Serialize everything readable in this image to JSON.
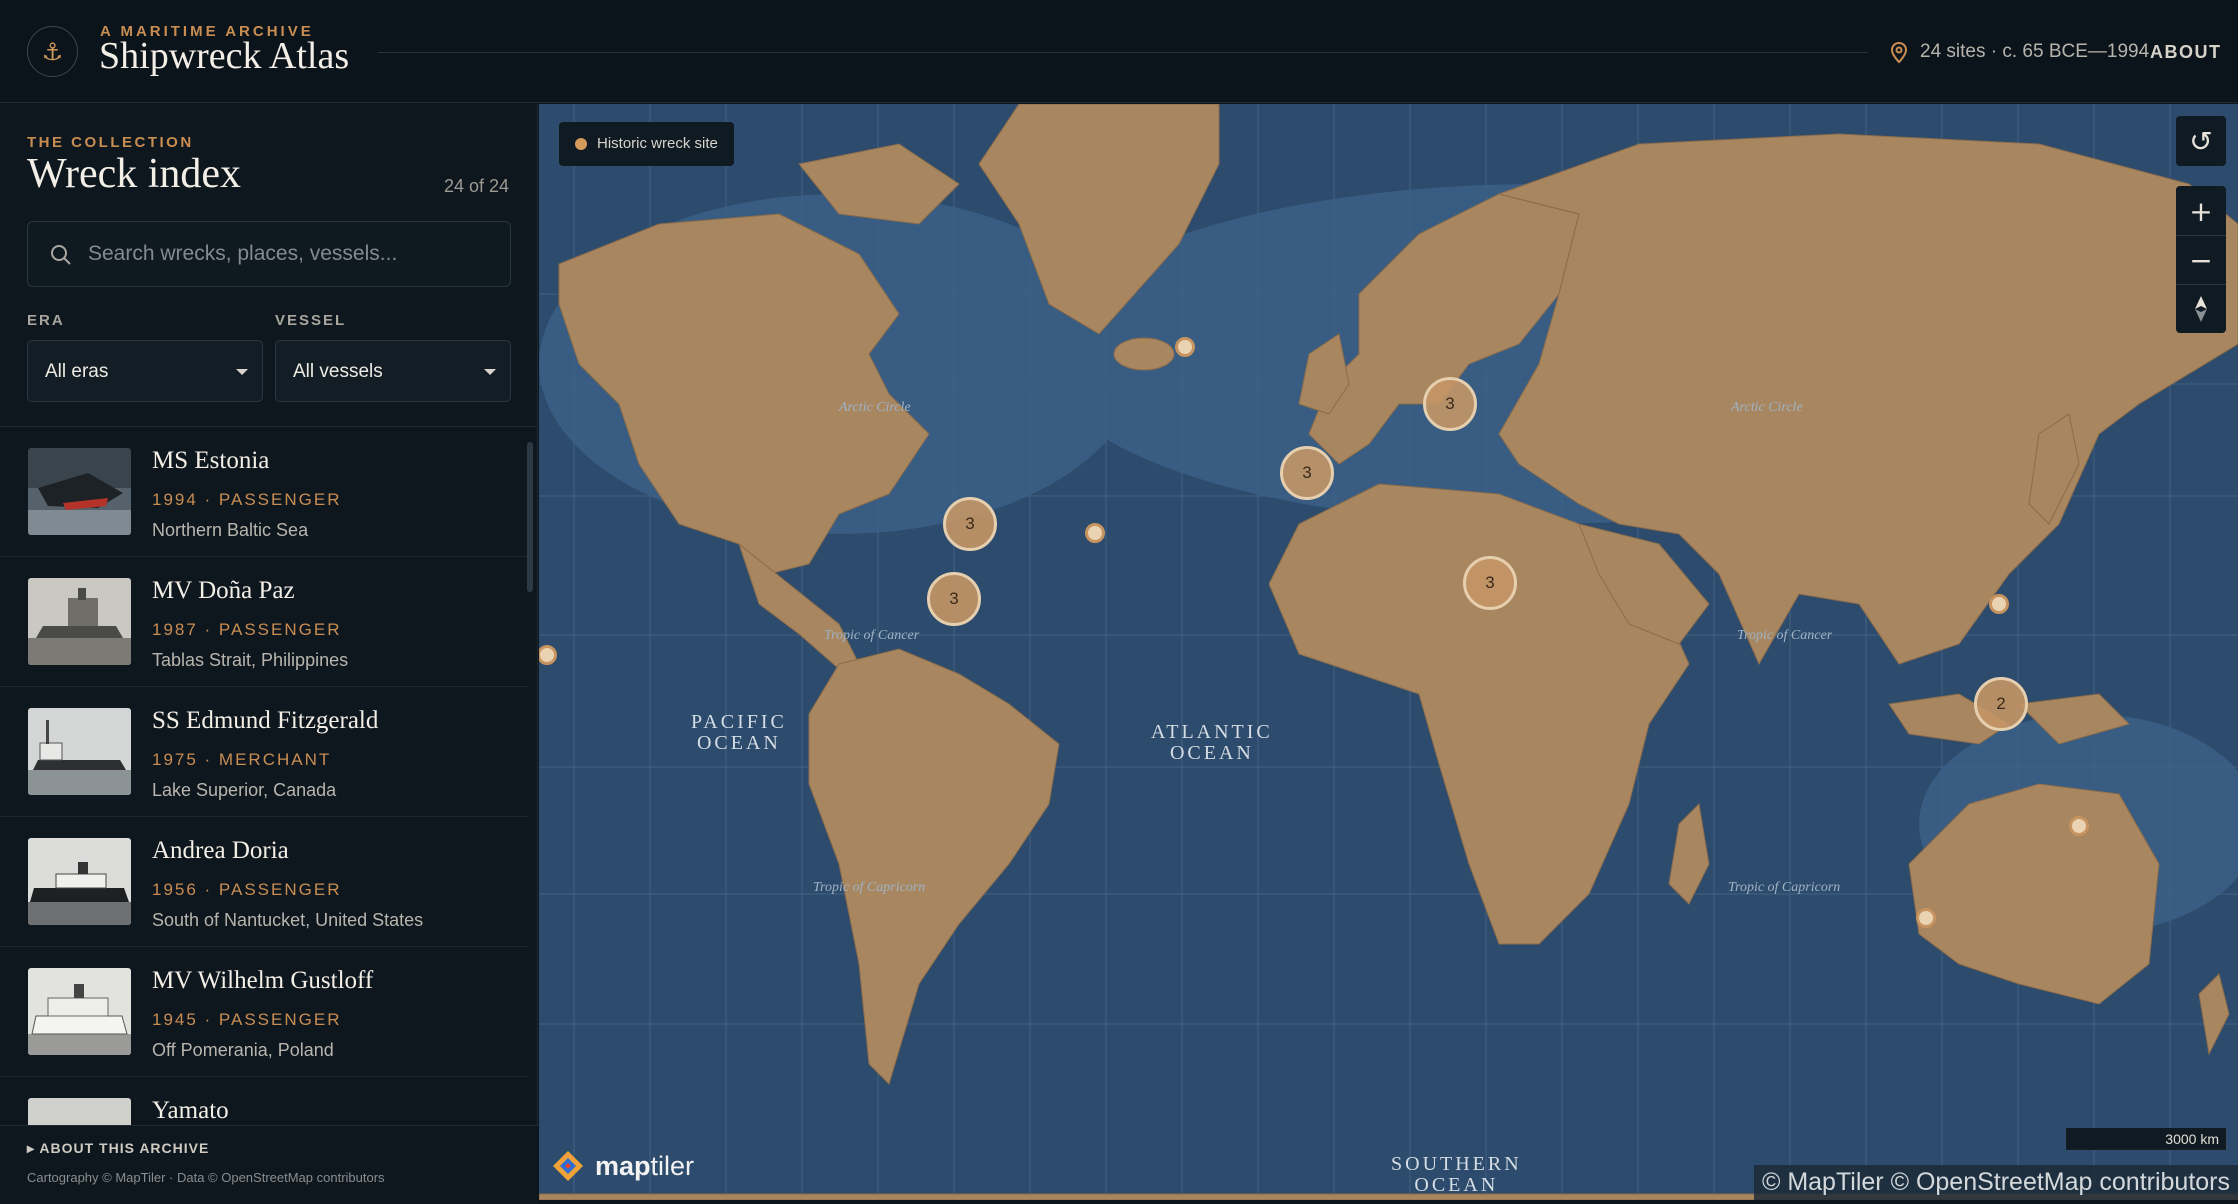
{
  "header": {
    "kicker": "A MARITIME ARCHIVE",
    "brand": "Shipwreck Atlas",
    "logo_icon": "anchor-icon",
    "site_count": "24 sites · c. 65 BCE—1994",
    "about": "ABOUT"
  },
  "sidebar": {
    "kicker": "THE COLLECTION",
    "title": "Wreck index",
    "count": "24 of 24",
    "search_placeholder": "Search wrecks, places, vessels...",
    "era_label": "ERA",
    "era_value": "All eras",
    "vessel_label": "VESSEL",
    "vessel_value": "All vessels",
    "items": [
      {
        "name": "MS Estonia",
        "meta": "1994 · PASSENGER",
        "location": "Northern Baltic Sea"
      },
      {
        "name": "MV Doña Paz",
        "meta": "1987 · PASSENGER",
        "location": "Tablas Strait, Philippines"
      },
      {
        "name": "SS Edmund Fitzgerald",
        "meta": "1975 · MERCHANT",
        "location": "Lake Superior, Canada"
      },
      {
        "name": "Andrea Doria",
        "meta": "1956 · PASSENGER",
        "location": "South of Nantucket, United States"
      },
      {
        "name": "MV Wilhelm Gustloff",
        "meta": "1945 · PASSENGER",
        "location": "Off Pomerania, Poland"
      },
      {
        "name": "Yamato",
        "meta": "",
        "location": ""
      }
    ],
    "about_archive": "▸ ABOUT THIS ARCHIVE",
    "credit": "Cartography © MapTiler · Data © OpenStreetMap contributors"
  },
  "map": {
    "legend": "Historic wreck site",
    "clusters": [
      "3",
      "3",
      "3",
      "3",
      "3",
      "2"
    ],
    "oceans": {
      "pacific": "PACIFIC\nOCEAN",
      "atlantic": "ATLANTIC\nOCEAN",
      "southern": "SOUTHERN\nOCEAN"
    },
    "lines": {
      "arctic": "Arctic Circle",
      "cancer": "Tropic of Cancer",
      "capricorn": "Tropic of Capricorn"
    },
    "maptiler_word_a": "map",
    "maptiler_word_b": "tiler",
    "scale": "3000 km",
    "attribution": "© MapTiler © OpenStreetMap contributors",
    "controls": [
      "reset-icon",
      "zoom-in-icon",
      "zoom-out-icon",
      "compass-icon"
    ]
  },
  "colors": {
    "accent": "#c98d52",
    "land": "#a88660",
    "ocean": "#2c4a6b",
    "marker": "#e9d3b3"
  }
}
